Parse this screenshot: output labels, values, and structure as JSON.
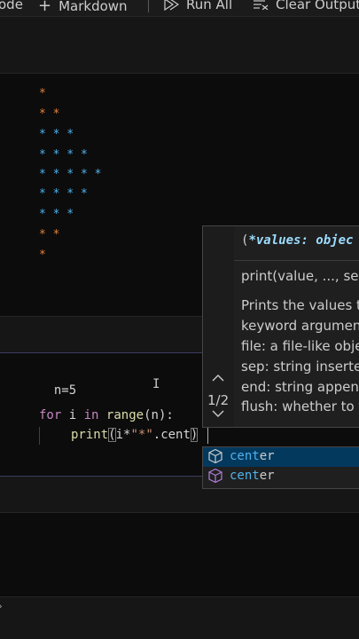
{
  "toolbar": {
    "code_label": "ode",
    "markdown_label": "Markdown",
    "run_all_label": "Run All",
    "clear_outputs_label": "Clear Outputs"
  },
  "output": {
    "lines": [
      {
        "text": "*",
        "color": "orange"
      },
      {
        "text": "* *",
        "color": "orange"
      },
      {
        "text": "* * *",
        "color": "blue"
      },
      {
        "text": "* * * *",
        "color": "blue"
      },
      {
        "text": "* * * * *",
        "color": "blue"
      },
      {
        "text": "* * * *",
        "color": "blue"
      },
      {
        "text": "* * *",
        "color": "blue"
      },
      {
        "text": "* *",
        "color": "orange"
      },
      {
        "text": "*",
        "color": "orange"
      }
    ]
  },
  "code": {
    "line1": "n=5",
    "line3_kw": "for",
    "line3_var": "i",
    "line3_in": "in",
    "line3_fn": "range",
    "line3_arg": "n",
    "line4_fn": "print",
    "line4_var": "i",
    "line4_str": "\"*\"",
    "line4_rest": ".cent"
  },
  "hover": {
    "signature_bold": "*values: objec",
    "signature_open": "(",
    "signature_line": "print(value, ..., sep",
    "doc_lines": [
      "Prints the values to",
      "keyword argumen",
      "file: a file-like obje",
      "sep: string inserted",
      "end: string append",
      "flush: whether to f"
    ],
    "overload_count": "1/2"
  },
  "suggestions": [
    {
      "match": "cent",
      "rest": "er",
      "selected": true,
      "icon": "method-cube-icon"
    },
    {
      "match": "cent",
      "rest": "er",
      "selected": false,
      "icon": "method-cube-icon"
    }
  ],
  "colors": {
    "star_orange": "#e0823e",
    "star_blue": "#4fb2ee",
    "accent": "#4fb2ee",
    "suggest_selected": "#04395e"
  }
}
